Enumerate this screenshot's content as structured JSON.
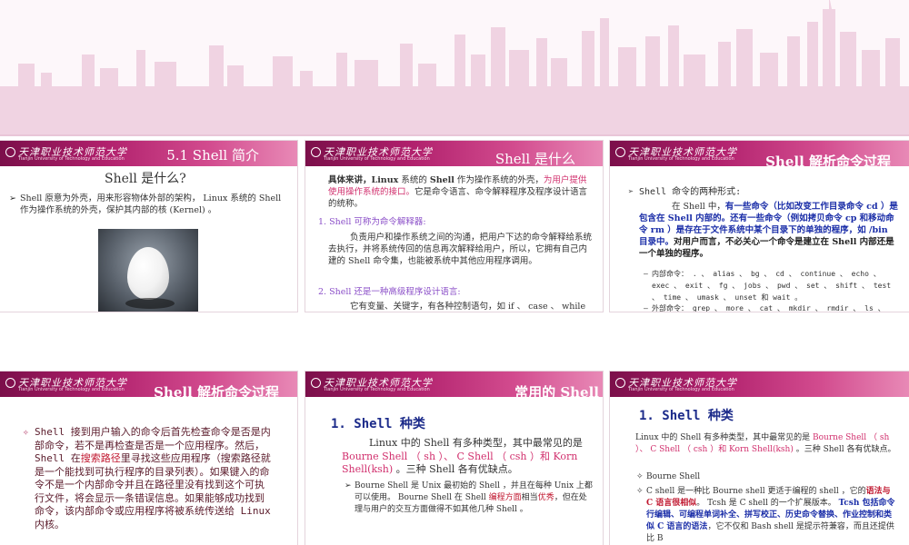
{
  "slides": [
    {
      "title": "5.1 Shell 简介",
      "heading": "Shell 是什么?",
      "bullet": "Shell 原意为外壳，用来形容物体外部的架构， Linux 系统的 Shell 作为操作系统的外壳，保护其内部的核 (Kernel) 。"
    },
    {
      "title": "Shell 是什么",
      "intro_lead": "具体来讲，",
      "intro_a": "Linux",
      "intro_b": " 系统的 ",
      "intro_c": "Shell",
      "intro_d": " 作为操作系统的外壳，",
      "intro_red": "为用户提供使用操作系统的接口。",
      "intro_e": "它是命令语言、命令解释程序及程序设计语言的统称。",
      "item1_title": "1. Shell 可称为命令解释器:",
      "item1_body": "负责用户和操作系统之间的沟通，把用户下达的命令解释给系统去执行，并将系统传回的信息再次解释给用户，所以，它拥有自己内建的 Shell 命令集，也能被系统中其他应用程序调用。",
      "item2_title": "2. Shell 还是一种高级程序设计语言:",
      "item2_body": "它有变量、关键字，有各种控制语句，如 if 、 case 、 while 、 for 等语句，有自己的语法结构。利用 Shell 程序设计语言可以编写出功能强大的代码程序。"
    },
    {
      "title": "Shell 解析命令过程",
      "lead": "Shell 命令的两种形式:",
      "para_a": "在 Shell 中，",
      "para_blue": "有一些命令（比如改变工作目录命令 cd ）是包含在 Shell 内部的。还有一些命令（例如拷贝命令 cp 和移动命令 rm ）是存在于文件系统中某个目录下的单独的程序，如 /bin 目录中。",
      "para_b": "对用户而言，不必关心一个命令是建立在 Shell 内部还是一个单独的程序。",
      "sub1": "内部命令： . 、 alias 、 bg 、 cd 、 continue 、 echo 、 exec 、 exit 、 fg 、 jobs 、 pwd 、 set 、 shift 、 test 、 time 、 umask 、 unset 和 wait 。",
      "sub2": "外部命令： grep 、 more 、 cat 、 mkdir 、 rmdir 、 ls 、 sort 、 ftp 、 telnet 、 lp 和 ps"
    },
    {
      "title": "Shell 解析命令过程",
      "a": "Shell 接到用户输入的命令后首先检查命令是否是内部命令，若不是再检查是否是一个应用程序。然后， Shell 在",
      "red": "搜索路径",
      "b": "里寻找这些应用程序（搜索路径就是一个能找到可执行程序的目录列表）。如果键入的命令不是一个内部命令并且在路径里没有找到这个可执行文件，将会显示一条错误信息。如果能够成功找到命令，该内部命令或应用程序将被系统传送给 Linux 内核。"
    },
    {
      "title": "常用的 Shell",
      "heading": "1. Shell 种类",
      "p_a": "Linux 中的 Shell 有多种类型，其中最常见的是 ",
      "p_pink": "Bourne Shell （ sh ）、 C Shell （ csh ）和 Korn Shell(ksh)",
      "p_b": " 。三种 Shell 各有优缺点。",
      "bullet_a": "Bourne Shell 是 Unix 最初始的 Shell ，并且在每种 Unix 上都可以使用。 Bourne Shell 在 Shell ",
      "bullet_red": "编程方面",
      "bullet_b": "相当",
      "bullet_red2": "优秀",
      "bullet_c": "，但在处理与用户的交互方面做得不如其他几种 Shell 。"
    },
    {
      "title": "",
      "heading": "1. Shell 种类",
      "p_a": "Linux 中的 Shell 有多种类型，其中最常见的是 ",
      "p_pink": "Bourne Shell （ sh ）、 C Shell （ csh ）和 Korn Shell(ksh)",
      "p_b": " 。三种 Shell 各有优缺点。",
      "b1": "Bourne Shell",
      "b2_a": "C shell 是一种比 Bourne shell 更适于编程的 shell ，它的",
      "b2_red": "语法与 C 语言很相似",
      "b2_b": "。 Tcsh 是 C shell 的一个扩展版本。 ",
      "b2_blue": "Tcsh 包括命令行编辑、可编程单词补全、拼写校正、历史命令替换、作业控制和类似 C 语言的语法",
      "b2_c": "，它不仅和 Bash shell 是提示符兼容，而且还提供比 B"
    }
  ],
  "logo": {
    "cn": "天津职业技术师范大学",
    "en": "Tianjin University of Technology and Education"
  },
  "colors": {
    "header_dark": "#7b0f4a",
    "header_light": "#e889b6",
    "accent_red": "#c0172f",
    "accent_blue": "#1b2ea8"
  }
}
